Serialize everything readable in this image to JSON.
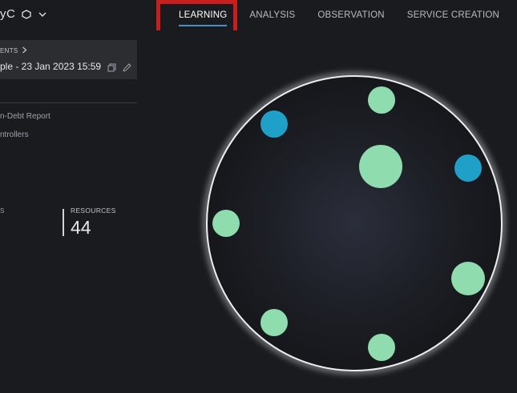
{
  "header": {
    "app_name": "yC",
    "nav": [
      {
        "label": "LEARNING",
        "active": true
      },
      {
        "label": "ANALYSIS",
        "active": false
      },
      {
        "label": "OBSERVATION",
        "active": false
      },
      {
        "label": "SERVICE CREATION",
        "active": false
      }
    ]
  },
  "run_panel": {
    "breadcrumb": "ENTS",
    "title": "ple - 23 Jan 2023 15:59"
  },
  "sidebar": {
    "links": [
      "n-Debt Report",
      "ntrollers"
    ]
  },
  "stats": {
    "resources_label": "RESOURCES",
    "resources_value": "44"
  },
  "visualization": {
    "colors": {
      "green": "#8fdcae",
      "blue": "#1fa0c9",
      "ring": "#e9eaee",
      "inner": "#23252e"
    }
  }
}
